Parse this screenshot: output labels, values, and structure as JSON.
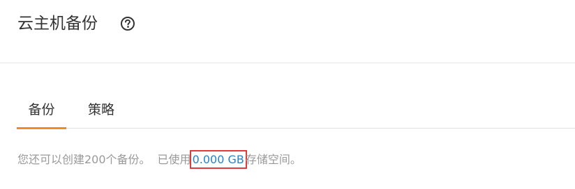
{
  "header": {
    "title": "云主机备份",
    "help_icon": "question-circle-icon"
  },
  "tabs": [
    {
      "label": "备份",
      "active": true
    },
    {
      "label": "策略",
      "active": false
    }
  ],
  "usage": {
    "remaining_text": "您还可以创建200个备份。",
    "used_prefix": "已使用",
    "used_value": "0.000 GB",
    "used_suffix": "存储空间。"
  },
  "colors": {
    "accent": "#f08a24",
    "link": "#2a82c4",
    "highlight_box": "#e03a3a"
  }
}
